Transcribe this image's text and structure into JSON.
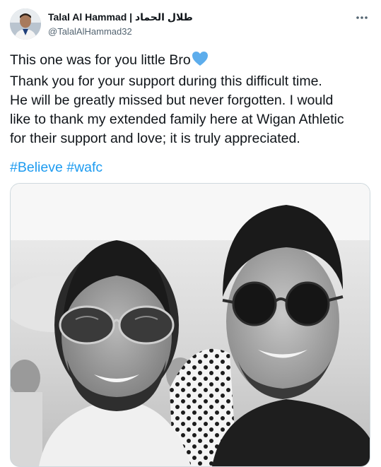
{
  "tweet": {
    "display_name": "Talal Al Hammad | طلال الحماد",
    "handle": "@TalalAlHammad32",
    "text_lines": [
      "This one was for you little Bro",
      "Thank you for your support during this difficult time.",
      "He will be greatly missed but never forgotten. I would",
      "like to thank my extended family here at Wigan Athletic",
      "for their support and love; it is truly appreciated."
    ],
    "hashtags": [
      "#Believe",
      "#wafc"
    ],
    "emoji_icon": "blue-heart-icon",
    "more_icon": "more-options-icon"
  },
  "colors": {
    "link": "#1d9bf0",
    "heart": "#5dadec",
    "secondary_text": "#536471",
    "border": "#cfd9de"
  }
}
